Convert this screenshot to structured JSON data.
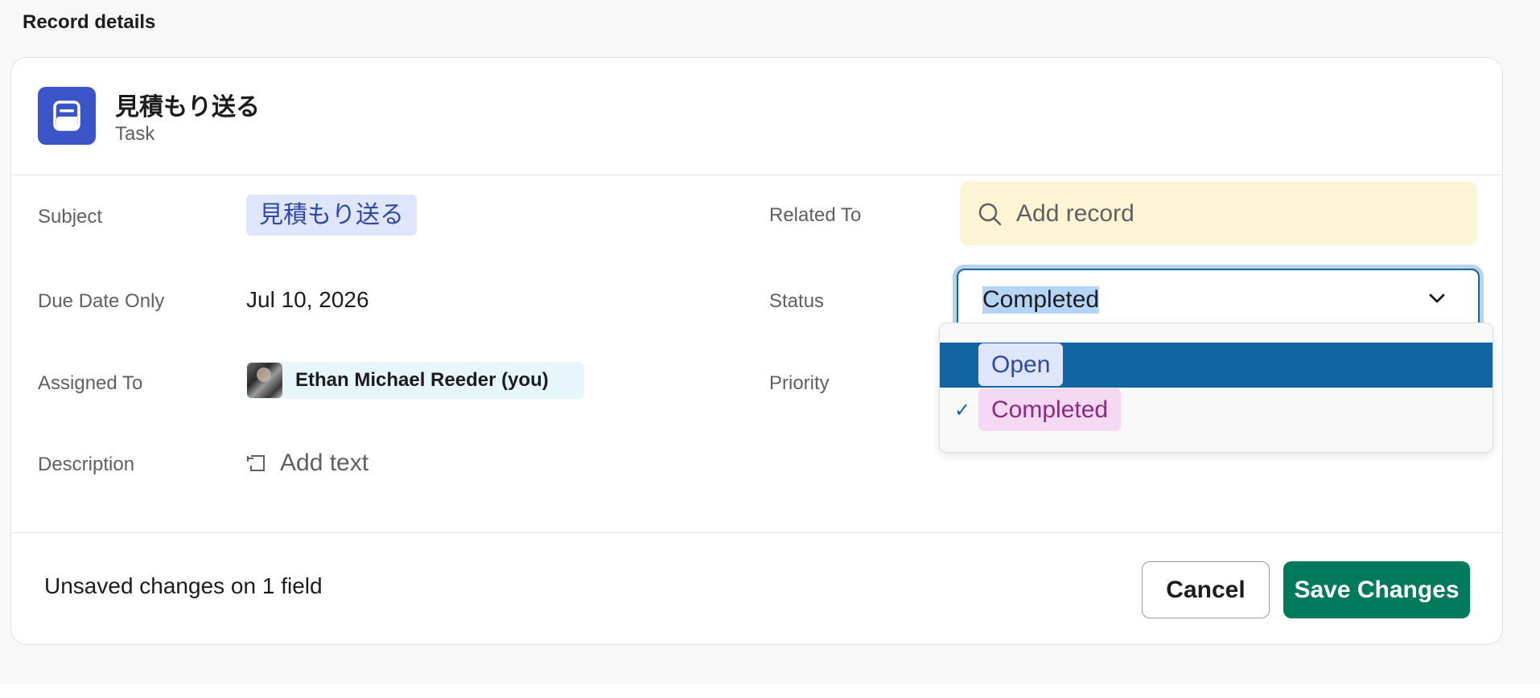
{
  "header": {
    "title": "Record details"
  },
  "record": {
    "title": "見積もり送る",
    "type": "Task",
    "icon": "task-icon",
    "icon_color": "#3b55c9"
  },
  "fields": {
    "subject_label": "Subject",
    "subject_value": "見積もり送る",
    "due_date_label": "Due Date Only",
    "due_date_value": "Jul 10, 2026",
    "assigned_to_label": "Assigned To",
    "assigned_to_value": "Ethan Michael Reeder (you)",
    "description_label": "Description",
    "description_placeholder": "Add text",
    "related_to_label": "Related To",
    "related_to_placeholder": "Add record",
    "status_label": "Status",
    "status_value": "Completed",
    "priority_label": "Priority"
  },
  "status_dropdown": {
    "options": [
      {
        "label": "Open",
        "highlighted": true,
        "checked": false
      },
      {
        "label": "Completed",
        "highlighted": false,
        "checked": true
      }
    ],
    "check_glyph": "✓"
  },
  "footer": {
    "unsaved_text": "Unsaved changes on 1 field",
    "cancel_label": "Cancel",
    "save_label": "Save Changes"
  },
  "colors": {
    "accent": "#1264a3",
    "save_button": "#007a5a",
    "related_bg": "#fdf4d5",
    "open_chip": "#dfe5fb",
    "completed_chip": "#f5d8f2"
  }
}
